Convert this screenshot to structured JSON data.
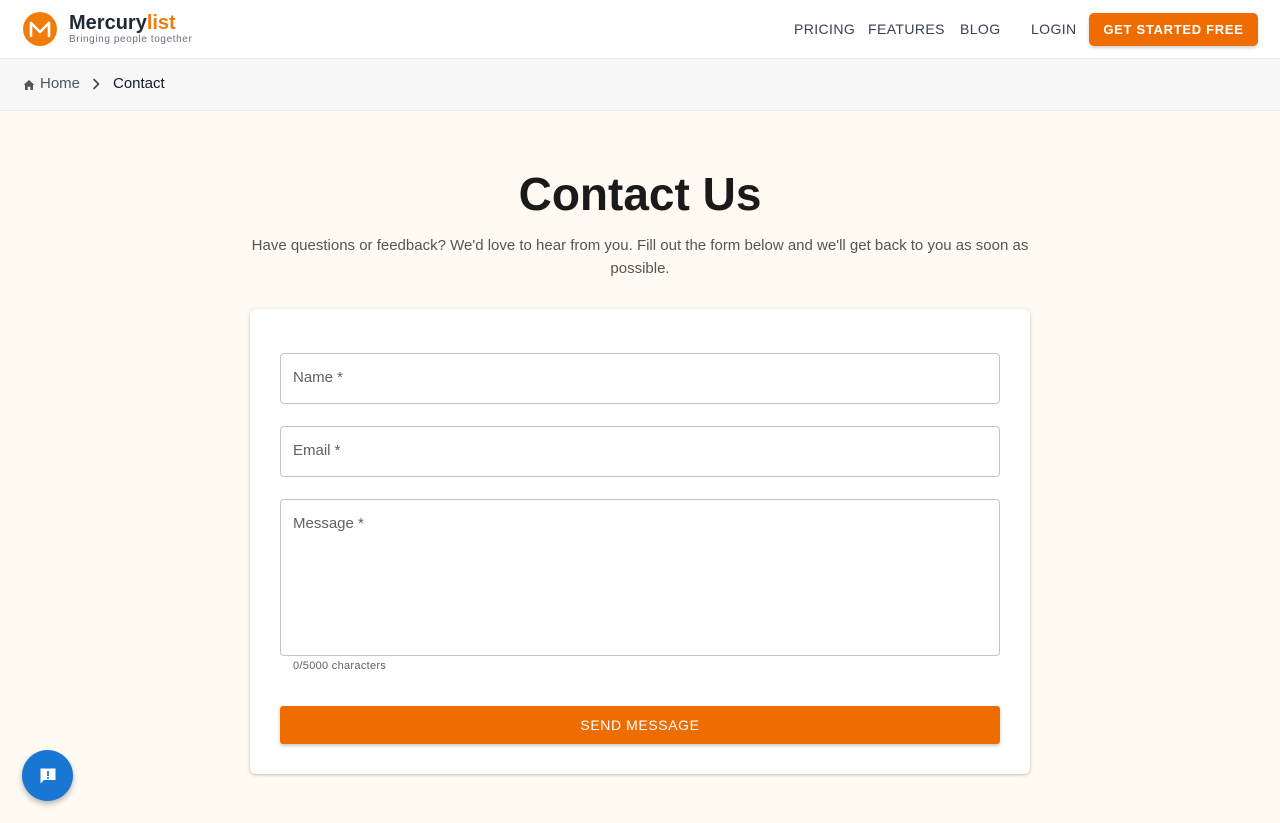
{
  "brand": {
    "name_primary": "Mercury",
    "name_accent": "list",
    "tagline": "Bringing people together",
    "logo_icon": "m-logo-icon",
    "accent_color": "#ef6c00"
  },
  "nav": {
    "pricing": "PRICING",
    "features": "FEATURES",
    "blog": "BLOG",
    "login": "LOGIN",
    "cta": "GET STARTED FREE"
  },
  "breadcrumb": {
    "home_icon": "home-icon",
    "home": "Home",
    "separator_icon": "chevron-right-icon",
    "current": "Contact"
  },
  "main": {
    "title": "Contact Us",
    "subtitle": "Have questions or feedback? We'd love to hear from you. Fill out the form below and we'll get back to you as soon as possible."
  },
  "form": {
    "name_label": "Name *",
    "email_label": "Email *",
    "message_label": "Message *",
    "name_value": "",
    "email_value": "",
    "message_value": "",
    "char_count": "0/5000 characters",
    "submit": "SEND MESSAGE"
  },
  "fab": {
    "icon": "feedback-icon",
    "color": "#1976d2"
  }
}
